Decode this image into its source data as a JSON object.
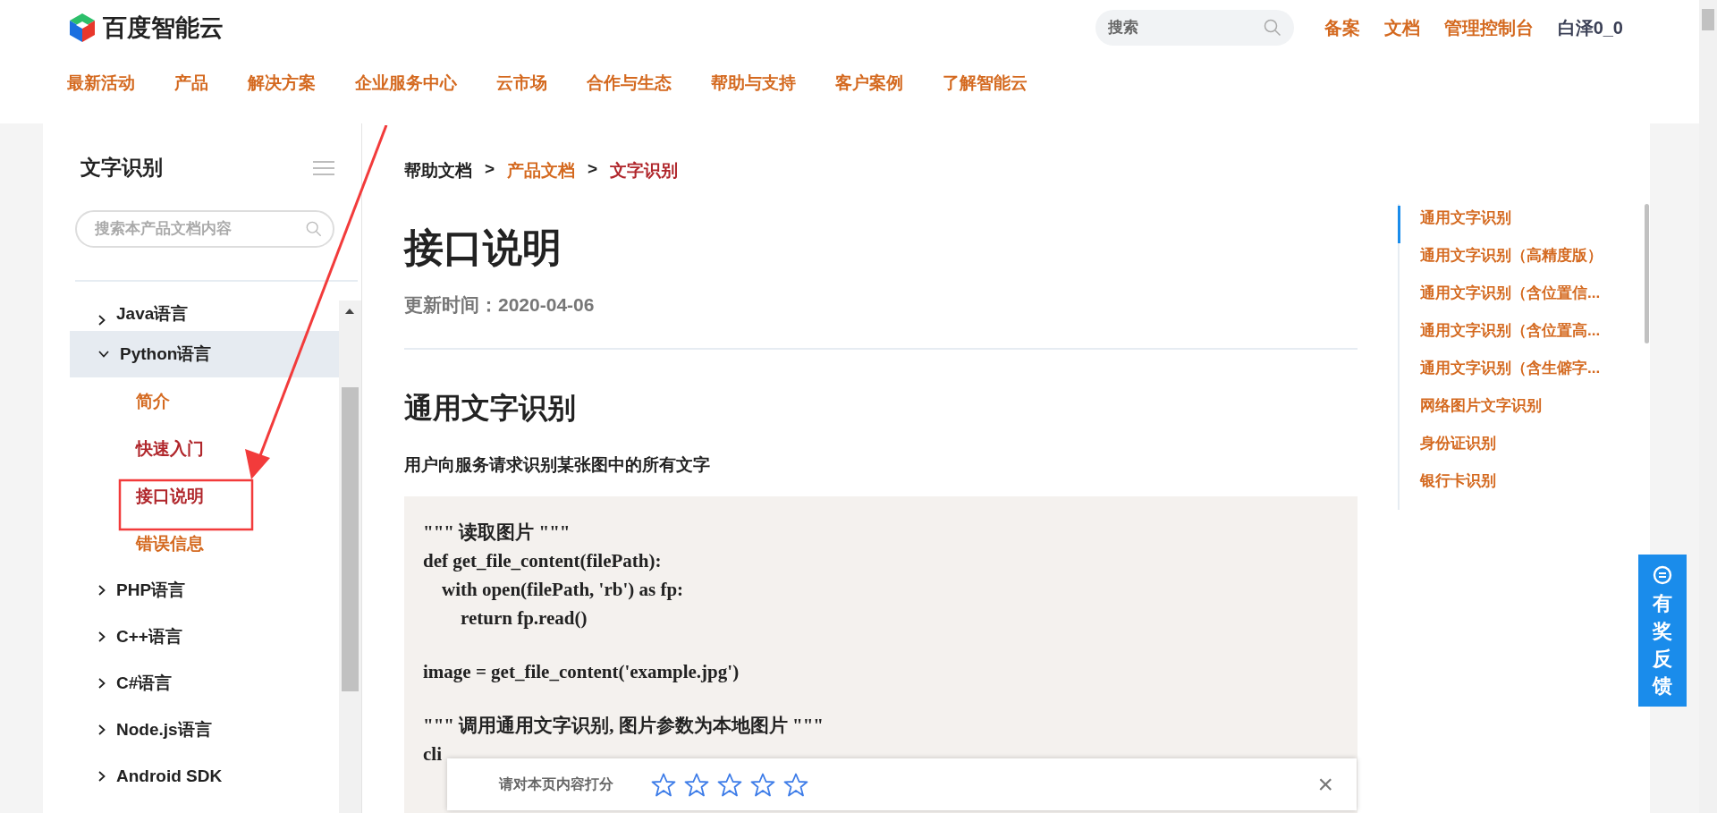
{
  "header": {
    "logo": "百度智能云",
    "search": {
      "placeholder": "搜索"
    },
    "links": [
      "备案",
      "文档",
      "管理控制台"
    ],
    "user": "白泽0_0",
    "nav": [
      "最新活动",
      "产品",
      "解决方案",
      "企业服务中心",
      "云市场",
      "合作与生态",
      "帮助与支持",
      "客户案例",
      "了解智能云"
    ]
  },
  "sidebar": {
    "title": "文字识别",
    "search": {
      "placeholder": "搜索本产品文档内容"
    },
    "tree": [
      {
        "label": "Java语言",
        "expanded": false
      },
      {
        "label": "Python语言",
        "expanded": true,
        "children": [
          {
            "label": "简介",
            "visited": false
          },
          {
            "label": "快速入门",
            "visited": true
          },
          {
            "label": "接口说明",
            "visited": true
          },
          {
            "label": "错误信息",
            "visited": false
          }
        ]
      },
      {
        "label": "PHP语言",
        "expanded": false
      },
      {
        "label": "C++语言",
        "expanded": false
      },
      {
        "label": "C#语言",
        "expanded": false
      },
      {
        "label": "Node.js语言",
        "expanded": false
      },
      {
        "label": "Android SDK",
        "expanded": false
      }
    ]
  },
  "breadcrumb": [
    {
      "label": "帮助文档",
      "kind": "plain"
    },
    {
      "label": "产品文档",
      "kind": "link"
    },
    {
      "label": "文字识别",
      "kind": "current"
    }
  ],
  "breadcrumb_separator": ">",
  "article": {
    "title": "接口说明",
    "updated": "更新时间：2020-04-06",
    "heading": "通用文字识别",
    "description": "用户向服务请求识别某张图中的所有文字",
    "code": [
      {
        "text": "\"\"\" 读取图片 \"\"\"",
        "gap_before": false
      },
      {
        "text": "def get_file_content(filePath):",
        "gap_before": false
      },
      {
        "text": "    with open(filePath, 'rb') as fp:",
        "gap_before": false
      },
      {
        "text": "        return fp.read()",
        "gap_before": false
      },
      {
        "text": "image = get_file_content('example.jpg')",
        "gap_before": true
      },
      {
        "text": "\"\"\" 调用通用文字识别, 图片参数为本地图片 \"\"\"",
        "gap_before": true
      },
      {
        "text": "cli",
        "gap_before": false
      }
    ]
  },
  "toc": [
    {
      "label": "通用文字识别",
      "selected": true
    },
    {
      "label": "通用文字识别（高精度版）",
      "selected": false
    },
    {
      "label": "通用文字识别（含位置信...",
      "selected": false
    },
    {
      "label": "通用文字识别（含位置高...",
      "selected": false
    },
    {
      "label": "通用文字识别（含生僻字...",
      "selected": false
    },
    {
      "label": "网络图片文字识别",
      "selected": false
    },
    {
      "label": "身份证识别",
      "selected": false
    },
    {
      "label": "银行卡识别",
      "selected": false
    }
  ],
  "feedback": "有奖反馈",
  "rating": {
    "prompt": "请对本页内容打分",
    "stars": 0,
    "close": "×"
  }
}
